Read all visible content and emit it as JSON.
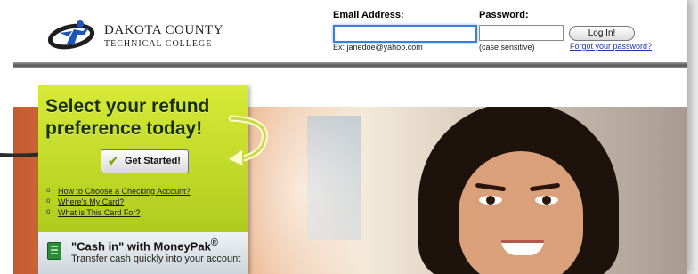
{
  "header": {
    "logo_line1": "DAKOTA COUNTY",
    "logo_line2": "TECHNICAL COLLEGE",
    "email_label": "Email Address:",
    "email_hint": "Ex: janedoe@yahoo.com",
    "email_value": "",
    "password_label": "Password:",
    "password_hint": "(case sensitive)",
    "password_value": "",
    "login_button": "Log In!",
    "forgot_link": "Forgot your password?"
  },
  "promo": {
    "headline": "Select your refund preference today!",
    "cta_button": "Get Started!",
    "links": [
      "How to Choose a Checking Account?",
      "Where's My Card?",
      "What is This Card For?"
    ]
  },
  "moneypak": {
    "title": "\"Cash in\" with MoneyPak",
    "title_mark": "®",
    "subtitle": "Transfer cash quickly into your account"
  },
  "colors": {
    "panel_green": "#c6df2a",
    "link_blue": "#1c3aa9",
    "focus_blue": "#3c7fd8",
    "logo_blue": "#1f55b8"
  },
  "icons": {
    "logo": "college-logo-icon",
    "check": "checkmark-icon",
    "card": "moneypak-card-icon"
  }
}
